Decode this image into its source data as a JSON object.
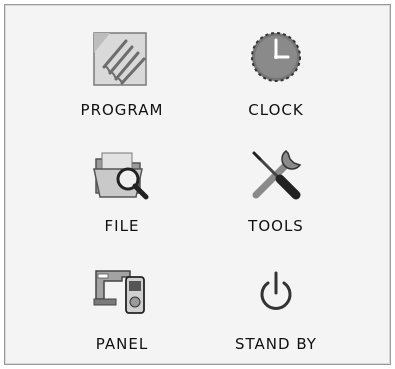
{
  "menu": {
    "items": [
      {
        "id": "program",
        "label": "PROGRAM",
        "icon": "program-icon"
      },
      {
        "id": "clock",
        "label": "CLOCK",
        "icon": "clock-icon"
      },
      {
        "id": "file",
        "label": "FILE",
        "icon": "file-folder-icon"
      },
      {
        "id": "tools",
        "label": "TOOLS",
        "icon": "tools-icon"
      },
      {
        "id": "panel",
        "label": "PANEL",
        "icon": "panel-icon"
      },
      {
        "id": "standby",
        "label": "STAND BY",
        "icon": "power-icon"
      }
    ]
  }
}
